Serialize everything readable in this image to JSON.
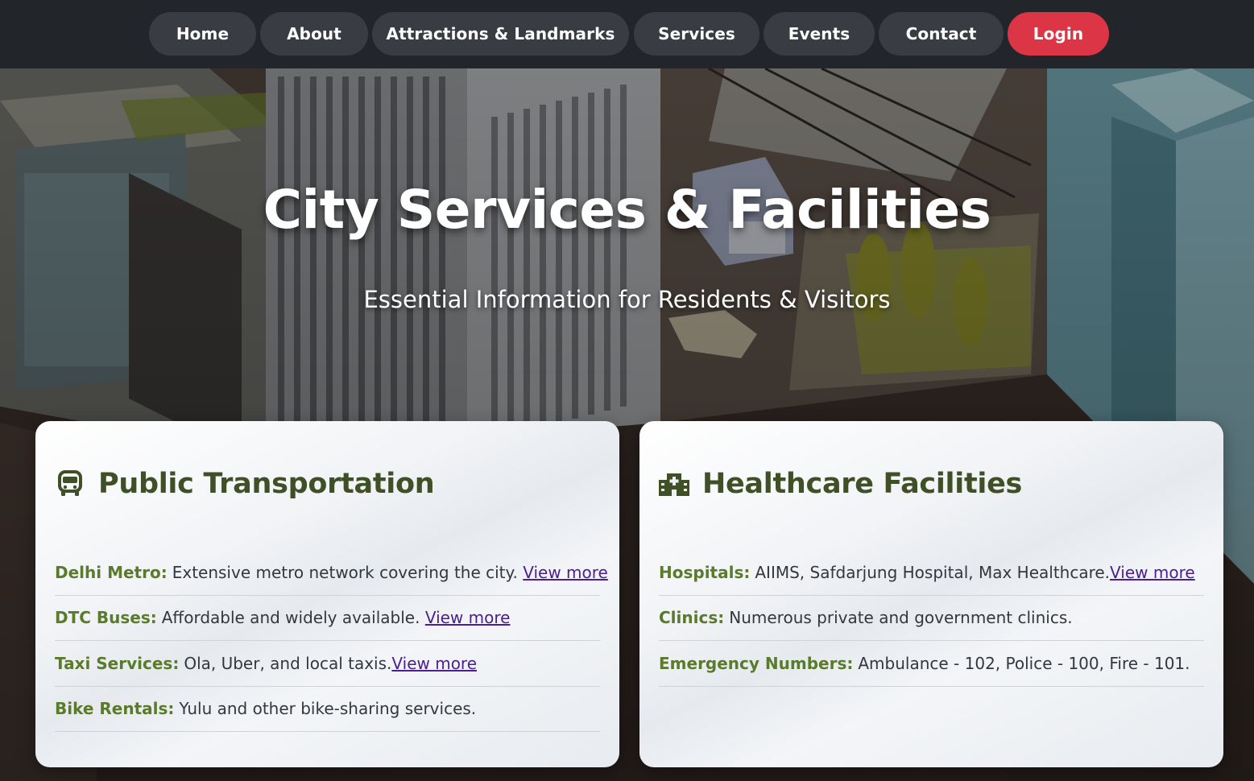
{
  "nav": {
    "items": [
      {
        "label": "Home"
      },
      {
        "label": "About"
      },
      {
        "label": "Attractions & Landmarks"
      },
      {
        "label": "Services"
      },
      {
        "label": "Events"
      },
      {
        "label": "Contact"
      }
    ],
    "login_label": "Login",
    "login_color": "#dc3545",
    "bar_color": "#22262b",
    "item_color": "#393d43"
  },
  "hero": {
    "title": "City Services & Facilities",
    "subtitle": "Essential Information for Residents & Visitors"
  },
  "cards": [
    {
      "icon": "bus-icon",
      "title": "Public Transportation",
      "items": [
        {
          "label": "Delhi Metro:",
          "text": "Extensive metro network covering the city.",
          "link": "View more"
        },
        {
          "label": "DTC Buses:",
          "text": "Affordable and widely available.",
          "link": "View more"
        },
        {
          "label": "Taxi Services:",
          "text": "Ola, Uber, and local taxis.",
          "link": "View more"
        },
        {
          "label": "Bike Rentals:",
          "text": "Yulu and other bike-sharing services.",
          "link": ""
        }
      ]
    },
    {
      "icon": "hospital-icon",
      "title": "Healthcare Facilities",
      "items": [
        {
          "label": "Hospitals:",
          "text": "AIIMS, Safdarjung Hospital, Max Healthcare.",
          "link": "View more"
        },
        {
          "label": "Clinics:",
          "text": "Numerous private and government clinics.",
          "link": ""
        },
        {
          "label": "Emergency Numbers:",
          "text": "Ambulance - 102, Police - 100, Fire - 101.",
          "link": ""
        }
      ]
    }
  ],
  "colors": {
    "heading": "#3f5026",
    "label": "#5a7a2c",
    "link": "#4a1f8e"
  }
}
